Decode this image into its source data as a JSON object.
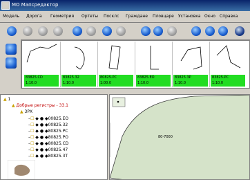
{
  "window": {
    "title": "MO Мапсредактор"
  },
  "menu": [
    "Модель",
    "Дорога",
    "Геометрия",
    "Ортеты",
    "Посклс",
    "Граждане",
    "Пловцаре",
    "Установка",
    "Окно",
    "Справка"
  ],
  "toolbar_icons": [
    "record-icon",
    "back-icon",
    "forward-icon",
    "up-icon",
    "layer-icon",
    "nav-icon",
    "sync-icon",
    "globe-icon",
    "refresh-icon",
    "zoom-icon",
    "home-icon",
    "print-icon",
    "help-icon",
    "exit-icon",
    "close-icon"
  ],
  "side_icons": [
    "view-icon",
    "map-icon"
  ],
  "thumbnails": [
    {
      "code": "83825.CD",
      "sub": "1:10.0"
    },
    {
      "code": "83825.32",
      "sub": "1:10.0"
    },
    {
      "code": "80825.PC",
      "sub": "1:00.0"
    },
    {
      "code": "83825.EO",
      "sub": "1:10.0"
    },
    {
      "code": "83825.3P",
      "sub": "1:10.0"
    },
    {
      "code": "83825.PC",
      "sub": "1:10.0"
    }
  ],
  "tree": {
    "root": "1",
    "group": "Добрые регистры - 33.1",
    "sub": "3РХ",
    "items": [
      "00825.EO",
      "00825.32",
      "80825.PC",
      "80825.PO",
      "80825.CD",
      "00825.47",
      "80825.3T"
    ]
  },
  "map": {
    "label": "80-7000"
  },
  "colors": {
    "map_green": "#d5e3c9",
    "thumb_label": "#22dd22",
    "tree_red": "#c00000"
  }
}
